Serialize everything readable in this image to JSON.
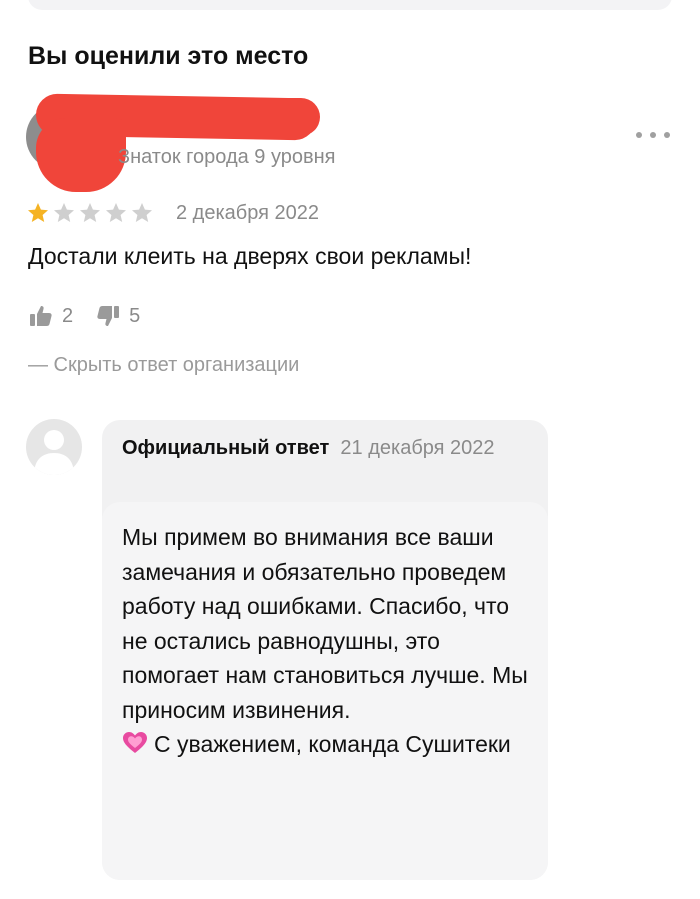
{
  "section": {
    "title": "Вы оценили это место"
  },
  "review": {
    "author_level": "Знаток города 9 уровня",
    "rating": 1,
    "rating_max": 5,
    "date": "2 декабря 2022",
    "text": "Достали клеить на дверях свои рекламы!",
    "likes": "2",
    "dislikes": "5",
    "hide_answer_label": "— Скрыть ответ организации"
  },
  "reply": {
    "author": "Официальный ответ",
    "date": "21 декабря 2022",
    "body": "Мы примем во внимания все ваши замечания и обязательно проведем работу над ошибками. Спасибо, что не остались равнодушны, это помогает нам становиться лучше. Мы приносим извинения.",
    "signature": "С уважением, команда Сушитеки"
  },
  "colors": {
    "star_active": "#f5b324",
    "star_inactive": "#cfcfcf",
    "redaction": "#f0453a",
    "heart": "#e84aa0"
  },
  "icons": {
    "more": "more-dots-icon",
    "like": "thumbs-up-icon",
    "dislike": "thumbs-down-icon",
    "heart": "heart-emoji-icon"
  }
}
